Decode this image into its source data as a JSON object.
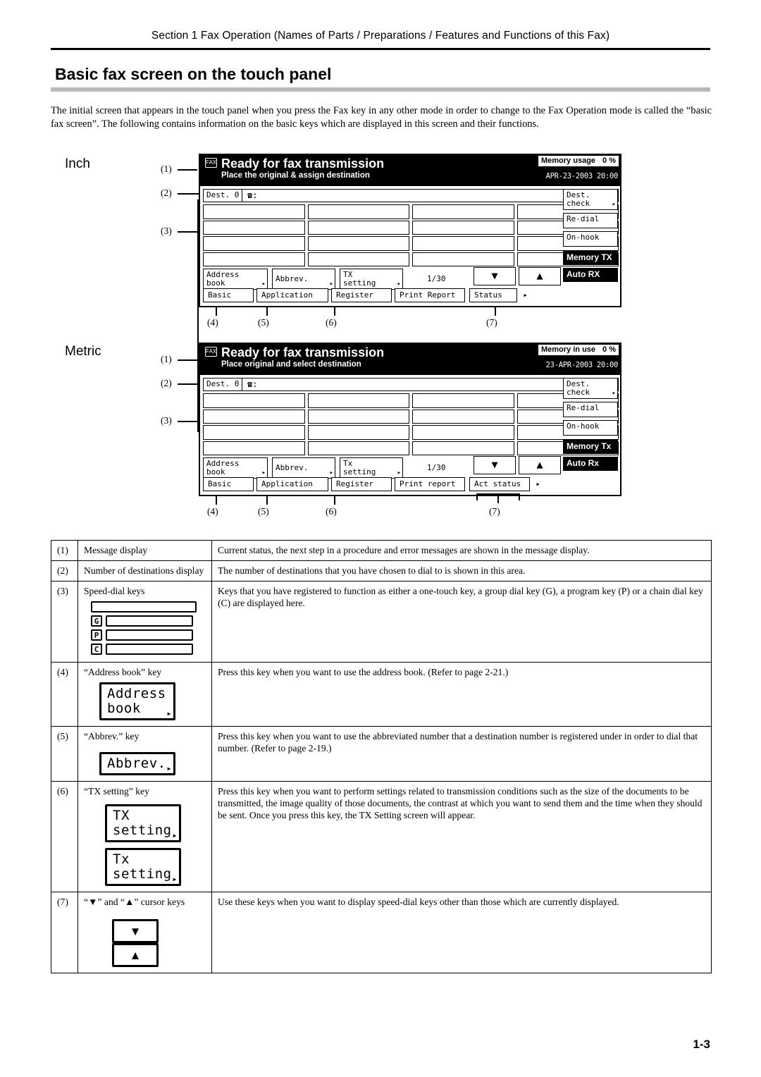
{
  "header": {
    "section": "Section 1  Fax Operation (Names of Parts / Preparations / Features and Functions of this Fax)"
  },
  "title": "Basic fax screen on the touch panel",
  "intro": "The initial screen that appears in the touch panel when you press the Fax key in any other mode in order to change to the Fax Operation mode is called the “basic fax screen”. The following contains information on the basic keys which are displayed in this screen and their functions.",
  "figures": {
    "inch_label": "Inch",
    "metric_label": "Metric",
    "callouts": [
      "(1)",
      "(2)",
      "(3)",
      "(4)",
      "(5)",
      "(6)",
      "(7)"
    ]
  },
  "panel_inch": {
    "fax_icon": "FAX",
    "title": "Ready for fax transmission",
    "subtitle": "Place the original & assign destination",
    "memory_label": "Memory usage",
    "memory_value": "0 %",
    "date": "APR-23-2003 20:00",
    "dest_tag": "Dest. 0",
    "phone_icon": "☎:",
    "keys": {
      "address_book": [
        "Address",
        "book"
      ],
      "abbrev": [
        "Abbrev."
      ],
      "tx_setting": [
        "TX",
        "setting"
      ],
      "page_count": "1/30",
      "down_arrow": "▼",
      "up_arrow": "▲"
    },
    "tabs": [
      "Basic",
      "Application",
      "Register",
      "Print Report",
      "Status"
    ],
    "side_keys": [
      "Dest.",
      "check",
      "Re-dial",
      "On-hook",
      "Memory TX",
      "Auto RX"
    ]
  },
  "panel_metric": {
    "fax_icon": "FAX",
    "title": "Ready for fax transmission",
    "subtitle": "Place original and select destination",
    "memory_label": "Memory in use",
    "memory_value": "0 %",
    "date": "23-APR-2003 20:00",
    "dest_tag": "Dest. 0",
    "phone_icon": "☎:",
    "keys": {
      "address_book": [
        "Address",
        "book"
      ],
      "abbrev": [
        "Abbrev."
      ],
      "tx_setting": [
        "Tx",
        "setting"
      ],
      "page_count": "1/30",
      "down_arrow": "▼",
      "up_arrow": "▲"
    },
    "tabs": [
      "Basic",
      "Application",
      "Register",
      "Print report",
      "Act status"
    ],
    "side_keys": [
      "Dest.",
      "check",
      "Re-dial",
      "On-hook",
      "Memory Tx",
      "Auto Rx"
    ]
  },
  "table": [
    {
      "num": "(1)",
      "name": "Message display",
      "desc": "Current status, the next step in a procedure and error messages are shown in the message display."
    },
    {
      "num": "(2)",
      "name": "Number of destinations display",
      "desc": "The number of destinations that you have chosen to dial to is shown in this area."
    },
    {
      "num": "(3)",
      "name": "Speed-dial keys",
      "desc": "Keys that you have registered to function as either a one-touch key, a group dial key (G), a program key (P) or a chain dial key (C) are displayed here.",
      "art": "speed-dial",
      "badges": [
        "G",
        "P",
        "C"
      ]
    },
    {
      "num": "(4)",
      "name": "“Address book” key",
      "desc": "Press this key when you want to use the address book. (Refer to page 2-21.)",
      "art": "key",
      "key_lines": [
        [
          "Address",
          "book"
        ]
      ]
    },
    {
      "num": "(5)",
      "name": "“Abbrev.” key",
      "desc": "Press this key when you want to use the abbreviated number that a destination number is registered under in order to dial that number. (Refer to page 2-19.)",
      "art": "key",
      "key_lines": [
        [
          "Abbrev."
        ]
      ]
    },
    {
      "num": "(6)",
      "name": "“TX setting” key",
      "desc": "Press this key when you want to perform settings related to transmission conditions such as the size of the documents to be transmitted, the image quality of those documents, the contrast at which you want to send them and the time when they should be sent. Once you press this key, the TX Setting screen will appear.",
      "art": "key2",
      "key_lines": [
        [
          "TX",
          "setting"
        ],
        [
          "Tx",
          "setting"
        ]
      ]
    },
    {
      "num": "(7)",
      "name": "“▼” and “▲” cursor keys",
      "desc": "Use these keys when you want to display speed-dial keys other than those which are currently displayed.",
      "art": "cursor",
      "cursor_keys": [
        "▼",
        "▲"
      ]
    }
  ],
  "footer": {
    "page": "1-3"
  }
}
